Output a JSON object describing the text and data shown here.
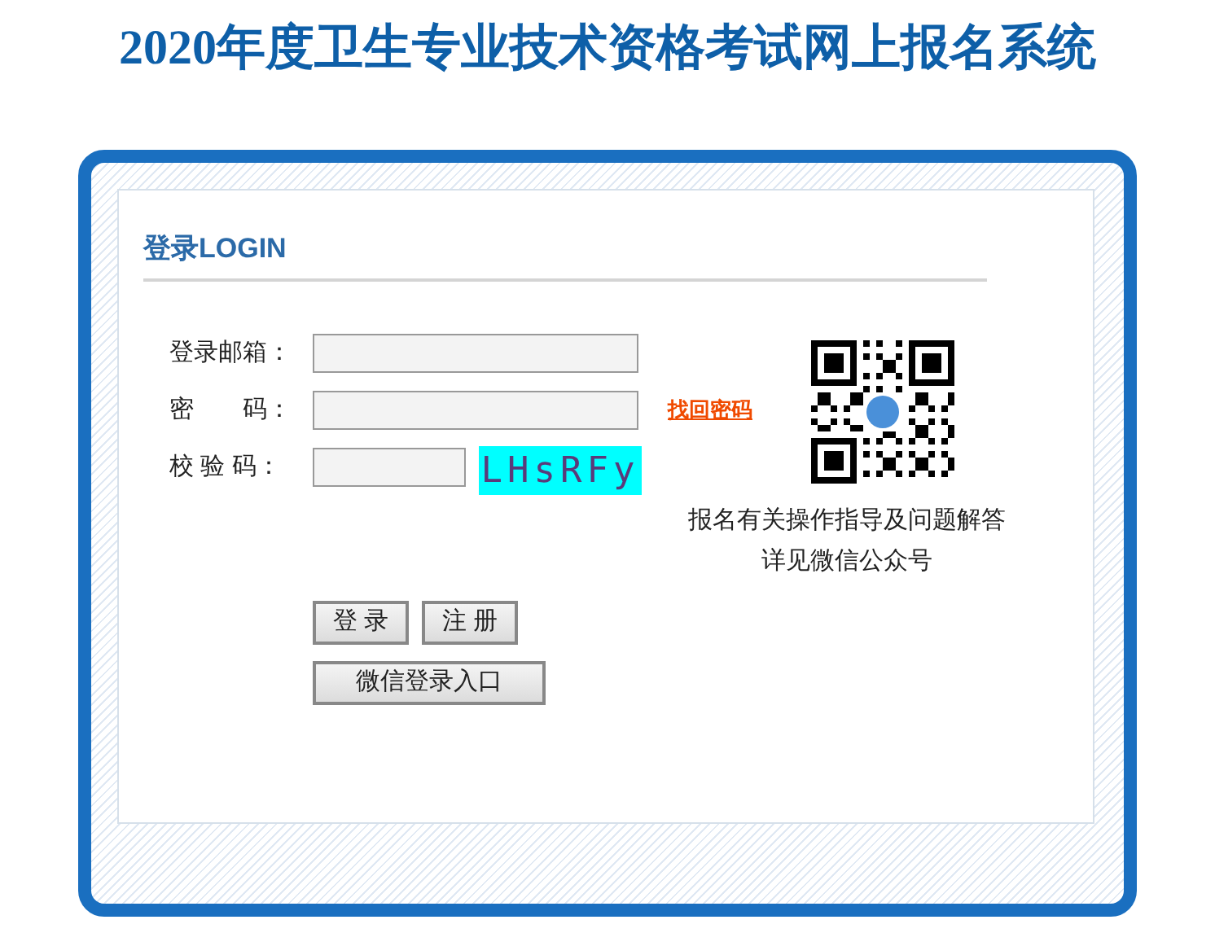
{
  "page_title": "2020年度卫生专业技术资格考试网上报名系统",
  "login": {
    "heading": "登录LOGIN",
    "fields": [
      {
        "label": "登录邮箱：",
        "kind": "email"
      },
      {
        "label": "密　　码：",
        "kind": "password",
        "link": "找回密码"
      },
      {
        "label": "校 验 码：",
        "kind": "captcha",
        "captcha": "LHsRFy"
      }
    ],
    "buttons": [
      "登 录",
      "注 册"
    ],
    "wechat_button": "微信登录入口"
  },
  "qr": {
    "caption": [
      "报名有关操作指导及问题解答",
      "详见微信公众号"
    ]
  }
}
